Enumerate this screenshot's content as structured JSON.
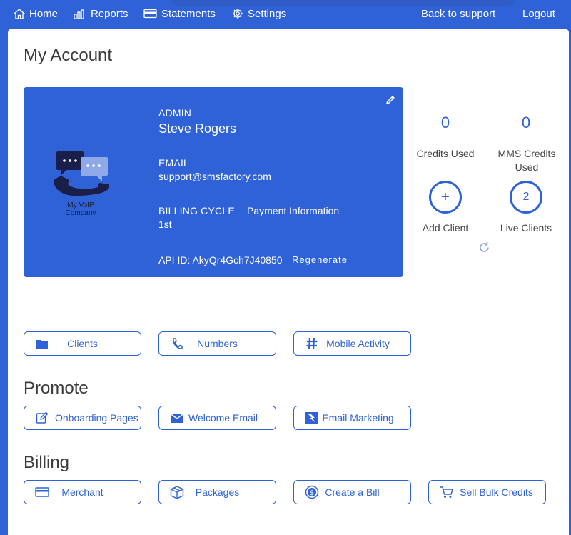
{
  "nav": {
    "home": "Home",
    "reports": "Reports",
    "statements": "Statements",
    "settings": "Settings",
    "back_to_support": "Back to support",
    "logout": "Logout"
  },
  "page_title": "My Account",
  "account": {
    "role_label": "ADMIN",
    "name": "Steve Rogers",
    "email_label": "EMAIL",
    "email": "support@smsfactory.com",
    "billing_label": "BILLING CYCLE",
    "billing_value": "1st",
    "payment_label": "Payment Information",
    "api_id": "API ID: AkyQr4Gch7J40850",
    "regenerate": "Regenerate",
    "company_name": "My VoIP Company"
  },
  "stats": {
    "credits_used_value": "0",
    "credits_used_label": "Credits Used",
    "mms_used_value": "0",
    "mms_used_label": "MMS Credits Used",
    "add_client_symbol": "+",
    "add_client_label": "Add Client",
    "live_clients_value": "2",
    "live_clients_label": "Live Clients"
  },
  "quick_links": {
    "clients": "Clients",
    "numbers": "Numbers",
    "mobile_activity": "Mobile Activity"
  },
  "promote": {
    "title": "Promote",
    "onboarding": "Onboarding Pages",
    "welcome_email": "Welcome Email",
    "email_marketing": "Email Marketing"
  },
  "billing": {
    "title": "Billing",
    "merchant": "Merchant",
    "packages": "Packages",
    "create_bill": "Create a Bill",
    "sell_bulk": "Sell Bulk Credits"
  },
  "colors": {
    "accent": "#2f62d6",
    "text": "#3b3b3b"
  }
}
